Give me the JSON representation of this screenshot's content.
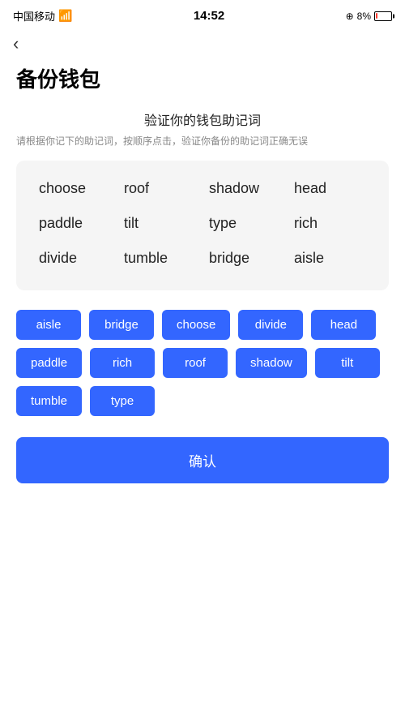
{
  "statusBar": {
    "carrier": "中国移动",
    "time": "14:52",
    "battery_pct": "8%"
  },
  "backLabel": "‹",
  "pageTitle": "备份钱包",
  "sectionTitle": "验证你的钱包助记词",
  "sectionDesc": "请根据你记下的助记词，按顺序点击，验证你备份的助记词正确无误",
  "displayWords": [
    "choose",
    "roof",
    "shadow",
    "head",
    "paddle",
    "tilt",
    "type",
    "rich",
    "divide",
    "tumble",
    "bridge",
    "aisle"
  ],
  "wordButtons": [
    "aisle",
    "bridge",
    "choose",
    "divide",
    "head",
    "paddle",
    "rich",
    "roof",
    "shadow",
    "tilt",
    "tumble",
    "type"
  ],
  "confirmLabel": "确认",
  "colors": {
    "blue": "#3366ff",
    "white": "#ffffff",
    "bg": "#ffffff",
    "cardBg": "#f5f5f5"
  }
}
